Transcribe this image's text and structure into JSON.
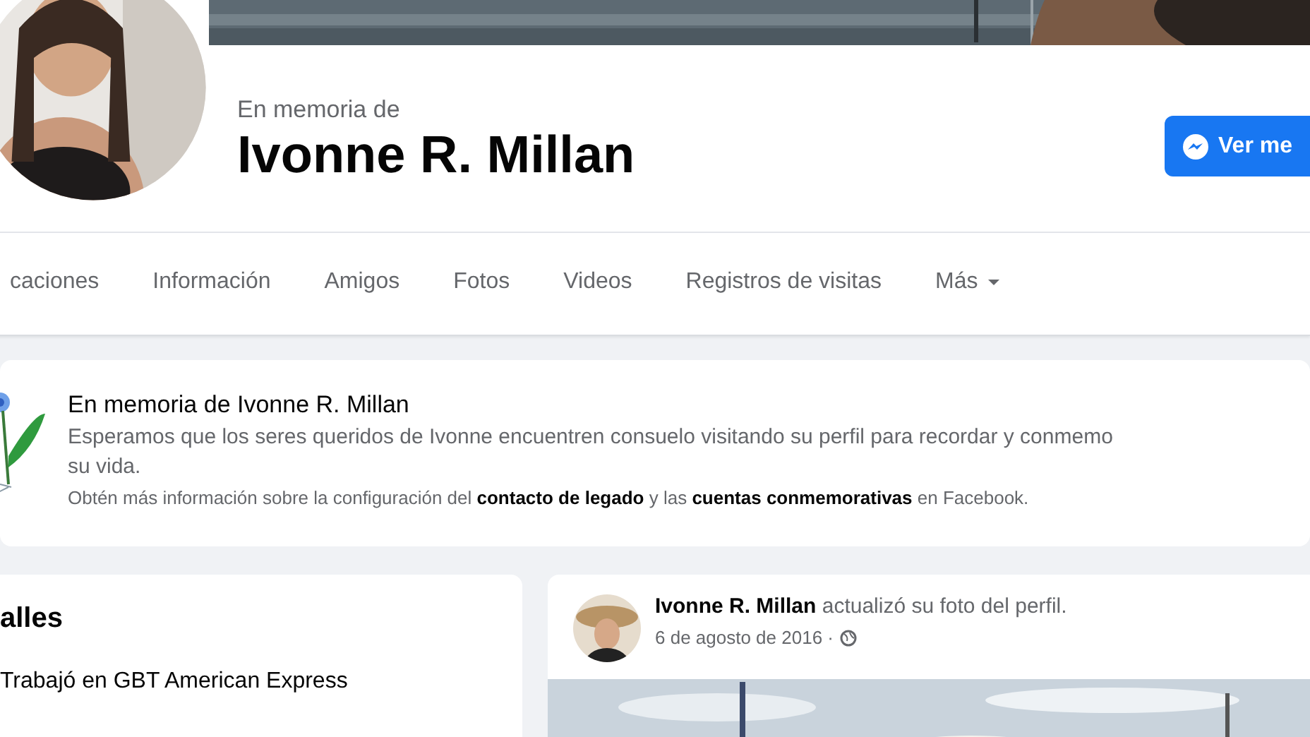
{
  "profile": {
    "memorial_label": "En memoria de",
    "name": "Ivonne R. Millan",
    "message_button": "Ver me"
  },
  "tabs": [
    {
      "label": "caciones",
      "selected": false
    },
    {
      "label": "Información",
      "selected": false
    },
    {
      "label": "Amigos",
      "selected": false
    },
    {
      "label": "Fotos",
      "selected": false
    },
    {
      "label": "Videos",
      "selected": false
    },
    {
      "label": "Registros de visitas",
      "selected": false
    },
    {
      "label": "Más",
      "selected": false,
      "dropdown": true
    }
  ],
  "memorial_notice": {
    "title": "En memoria de Ivonne R. Millan",
    "description_lines": [
      "Esperamos que los seres queridos de Ivonne encuentren consuelo visitando su perfil para recordar y conmemo",
      "su vida."
    ],
    "info": "Obtén más información sobre la configuración del **contacto de legado** y las **cuentas conmemorativas** en Facebook."
  },
  "details": {
    "title": "alles",
    "items": [
      "Trabajó en GBT American Express"
    ]
  },
  "post": {
    "headline": "**Ivonne R. Millan** actualizó su foto del perfil.",
    "date": "6 de agosto de 2016 ·"
  }
}
